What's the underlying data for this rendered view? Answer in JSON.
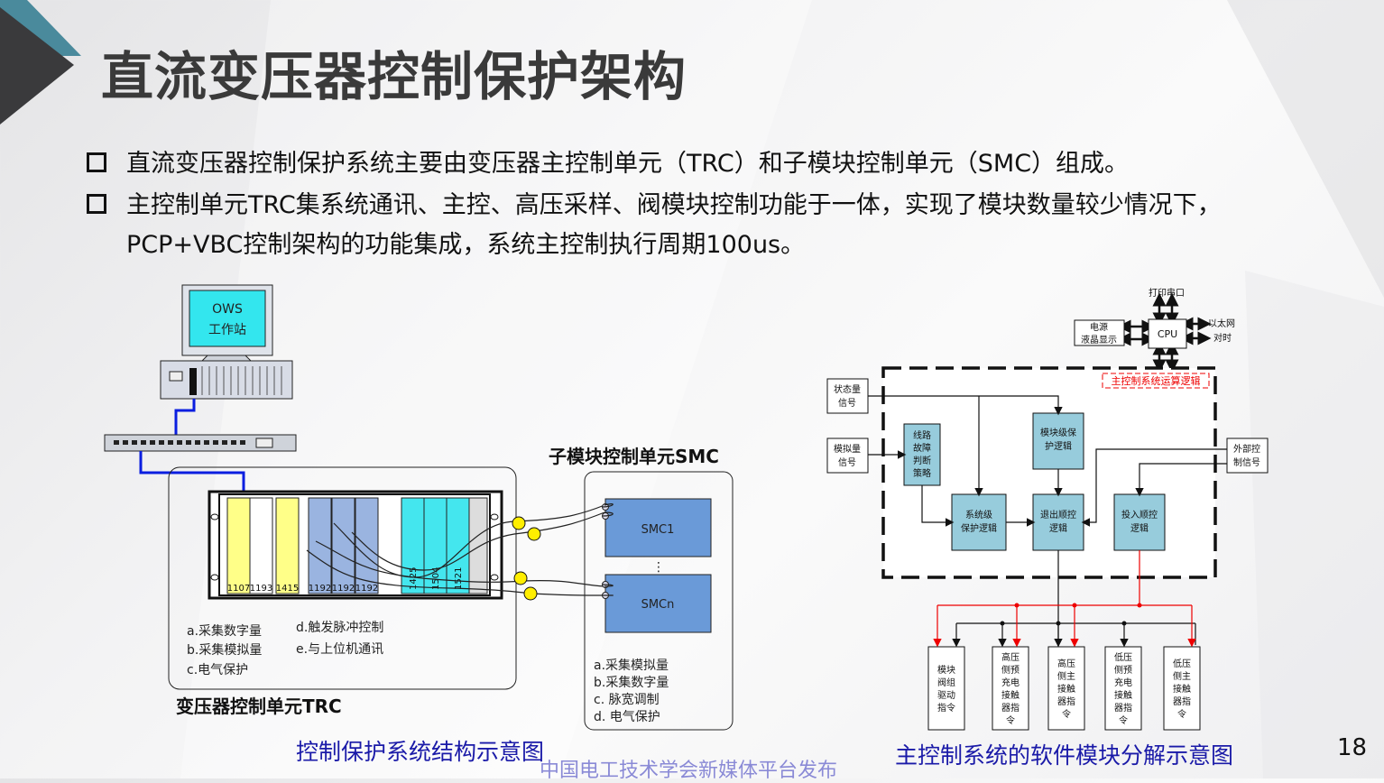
{
  "slide": {
    "title": "直流变压器控制保护架构",
    "page_number": "18",
    "watermark": "中国电工技术学会新媒体平台发布",
    "bullets": [
      {
        "line1": "直流变压器控制保护系统主要由变压器主控制单元（TRC）和子模块控制单元（SMC）组成。"
      },
      {
        "line1": "主控制单元TRC集系统通讯、主控、高压采样、阀模块控制功能于一体，实现了模块数量较少情况下，",
        "line2": "PCP+VBC控制架构的功能集成，系统主控制执行周期100us。"
      }
    ]
  },
  "left_diagram": {
    "caption": "控制保护系统结构示意图",
    "ows": {
      "line1": "OWS",
      "line2": "工作站"
    },
    "trc": {
      "label": "变压器控制单元TRC",
      "cards": [
        "1107",
        "1193",
        "1415",
        "1192",
        "1192",
        "1192",
        "1425",
        "1504",
        "1521"
      ],
      "functions": [
        "a.采集数字量",
        "b.采集模拟量",
        "c.电气保护",
        "d.触发脉冲控制",
        "e.与上位机通讯"
      ]
    },
    "smc": {
      "label": "子模块控制单元SMC",
      "units": [
        "SMC1",
        "SMCn"
      ],
      "ellipsis": "⋮",
      "functions": [
        "a.采集模拟量",
        "b.采集数字量",
        "c.  脉宽调制",
        "d.  电气保护"
      ]
    }
  },
  "right_diagram": {
    "caption": "主控制系统的软件模块分解示意图",
    "cpu": "CPU",
    "top_io": "打印串口",
    "left_io": {
      "line1": "电源",
      "line2": "液晶显示"
    },
    "right_io": [
      "以太网",
      "对时"
    ],
    "region_label": "主控制系统运算逻辑",
    "inputs": {
      "status": [
        "状态量",
        "信号"
      ],
      "analog": [
        "模拟量",
        "信号"
      ],
      "external": [
        "外部控",
        "制信号"
      ]
    },
    "blocks": {
      "line_fault": [
        "线路",
        "故障",
        "判断",
        "策略"
      ],
      "module_protect": [
        "模块级保",
        "护逻辑"
      ],
      "system_protect": [
        "系统级",
        "保护逻辑"
      ],
      "exit_seq": [
        "退出顺控",
        "逻辑"
      ],
      "enter_seq": [
        "投入顺控",
        "逻辑"
      ]
    },
    "outputs": [
      [
        "模块",
        "阀组",
        "驱动",
        "指令"
      ],
      [
        "高压",
        "侧预",
        "充电",
        "接触",
        "器指",
        "令"
      ],
      [
        "高压",
        "侧主",
        "接触",
        "器指",
        "令"
      ],
      [
        "低压",
        "侧预",
        "充电",
        "接触",
        "器指",
        "令"
      ],
      [
        "低压",
        "侧主",
        "接触",
        "器指",
        "令"
      ]
    ]
  }
}
